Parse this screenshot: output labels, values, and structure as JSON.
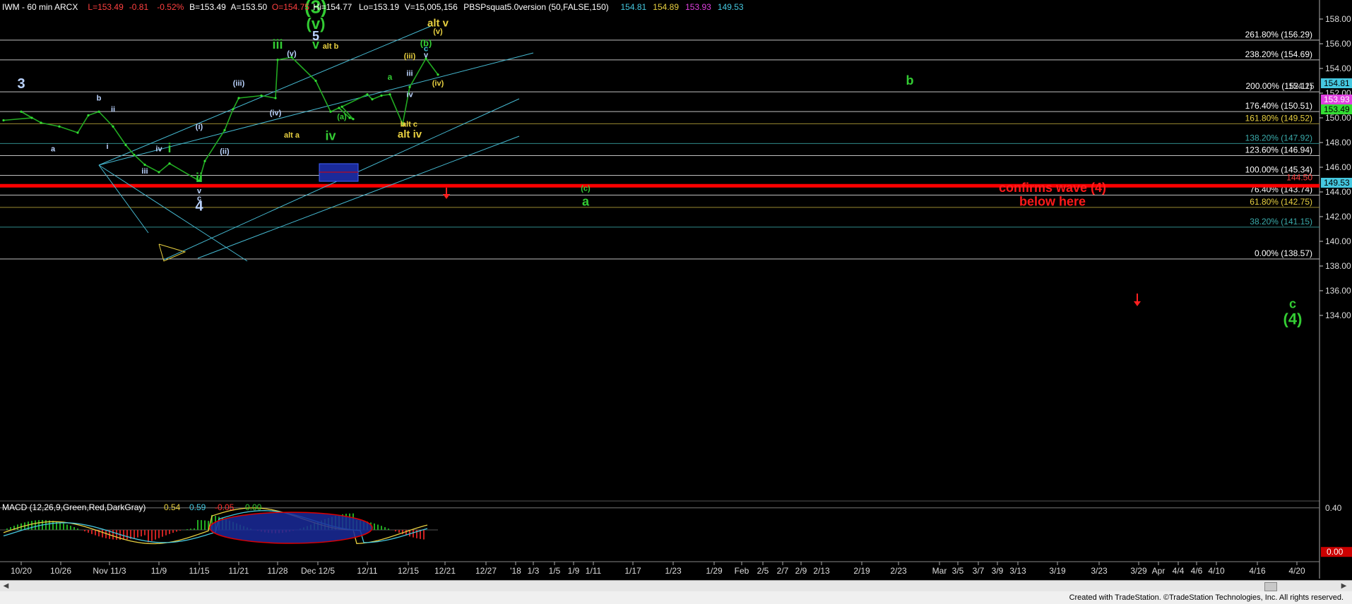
{
  "header": {
    "parts": [
      {
        "text": "IWM - 60 min  ARCX",
        "color": "#ffffff"
      },
      {
        "text": "L=153.49",
        "color": "#ff4040"
      },
      {
        "text": "-0.81",
        "color": "#ff4040"
      },
      {
        "text": "-0.52%",
        "color": "#ff4040"
      },
      {
        "text": "B=153.49",
        "color": "#ffffff"
      },
      {
        "text": "A=153.50",
        "color": "#ffffff"
      },
      {
        "text": "O=154.75",
        "color": "#ff4040"
      },
      {
        "text": "Hi=154.77",
        "color": "#ffffff"
      },
      {
        "text": "Lo=153.19",
        "color": "#ffffff"
      },
      {
        "text": "V=15,005,156",
        "color": "#ffffff"
      },
      {
        "text": "PBSPsquat5.0version (50,FALSE,150)",
        "color": "#ffffff"
      },
      {
        "text": "154.81",
        "color": "#45c8e0"
      },
      {
        "text": "154.89",
        "color": "#e8d040"
      },
      {
        "text": "153.93",
        "color": "#e040e0"
      },
      {
        "text": "149.53",
        "color": "#45c8e0"
      }
    ]
  },
  "macd": {
    "label": "MACD (12,26,9,Green,Red,DarkGray)",
    "values": [
      {
        "text": "0.54",
        "color": "#e8d040"
      },
      {
        "text": "0.59",
        "color": "#45c8e0"
      },
      {
        "text": "-0.05",
        "color": "#ff3030"
      },
      {
        "text": "0.00",
        "color": "#33cc33"
      }
    ],
    "axis_labels": [
      {
        "text": "0.40",
        "value": 0.4
      }
    ],
    "last_tag": {
      "text": "0.00",
      "value": -0.4
    }
  },
  "chart_data": {
    "type": "line",
    "title": "IWM - 60 min ARCX",
    "series": [
      {
        "name": "IWM",
        "x": [
          "10/16",
          "10/18",
          "10/20",
          "10/23",
          "10/26",
          "10/30",
          "11/1",
          "11/3",
          "11/6",
          "11/8",
          "11/9",
          "11/10",
          "11/13",
          "11/14",
          "11/15",
          "11/16",
          "11/17",
          "11/20",
          "11/21",
          "11/24",
          "11/27",
          "11/28",
          "11/29",
          "11/30",
          "12/1",
          "12/4",
          "12/5",
          "12/6",
          "12/7",
          "12/8",
          "12/11",
          "12/12",
          "12/13",
          "12/14",
          "12/15",
          "12/18",
          "12/19"
        ],
        "values": [
          149.8,
          150.0,
          150.5,
          149.6,
          149.3,
          148.8,
          150.2,
          150.5,
          149.3,
          147.8,
          147.0,
          146.2,
          145.6,
          146.3,
          144.9,
          146.5,
          149.0,
          150.7,
          151.6,
          151.8,
          151.6,
          154.7,
          154.9,
          153.0,
          150.5,
          150.8,
          150.0,
          149.9,
          150.9,
          151.9,
          151.5,
          151.8,
          151.9,
          149.5,
          152.5,
          154.8,
          153.5
        ]
      }
    ],
    "ylim": [
      132.0,
      159.0
    ],
    "y_ticks": [
      134,
      136,
      138,
      140,
      142,
      144,
      146,
      148,
      150,
      152,
      154,
      156,
      158
    ],
    "x_tick_labels": [
      "10/20",
      "10/26",
      "Nov 11/3",
      "11/9",
      "11/15",
      "11/21",
      "11/28",
      "Dec 12/5",
      "12/11",
      "12/15",
      "12/21",
      "12/27",
      "'18",
      "1/3",
      "1/5",
      "1/9",
      "1/11",
      "1/17",
      "1/23",
      "1/29",
      "Feb",
      "2/5",
      "2/7",
      "2/9",
      "2/13",
      "2/19",
      "2/23",
      "Mar",
      "3/5",
      "3/7",
      "3/9",
      "3/13",
      "3/19",
      "3/23",
      "3/29",
      "Apr",
      "4/4",
      "4/6",
      "4/10",
      "4/16",
      "4/20"
    ],
    "fib_levels": [
      {
        "label": "261.80% (156.29)",
        "value": 156.29,
        "color": "#ffffff"
      },
      {
        "label": "238.20% (154.69)",
        "value": 154.69,
        "color": "#ffffff"
      },
      {
        "label": "200.00% (152.11)",
        "value": 152.11,
        "color": "#ffffff"
      },
      {
        "label": "176.40% (150.51)",
        "value": 150.51,
        "color": "#ffffff"
      },
      {
        "label": "161.80% (149.52)",
        "value": 149.52,
        "color": "#e8d040"
      },
      {
        "label": "138.20% (147.92)",
        "value": 147.92,
        "color": "#3aaaaa"
      },
      {
        "label": "123.60% (146.94)",
        "value": 146.94,
        "color": "#ffffff"
      },
      {
        "label": "100.00% (145.34)",
        "value": 145.34,
        "color": "#ffffff"
      },
      {
        "label": "76.40% (143.74)",
        "value": 143.74,
        "color": "#ffffff"
      },
      {
        "label": "61.80% (142.75)",
        "value": 142.75,
        "color": "#e8d040"
      },
      {
        "label": "38.20% (141.15)",
        "value": 141.15,
        "color": "#3aaaaa"
      },
      {
        "label": "0.00% (138.57)",
        "value": 138.57,
        "color": "#ffffff"
      }
    ],
    "support_line": {
      "value": 144.5,
      "label": "144.50",
      "color": "#ff0000"
    },
    "price_tags": [
      {
        "text": "154.81",
        "value": 154.81,
        "bg": "#45c8e0",
        "fg": "#000000"
      },
      {
        "text": "154.25",
        "value": 154.25,
        "bg": "",
        "fg": "#cccccc"
      },
      {
        "text": "153.93",
        "value": 153.93,
        "bg": "#e040e0",
        "fg": "#ffffff"
      },
      {
        "text": "153.49",
        "value": 153.49,
        "bg": "#33dd33",
        "fg": "#000000"
      },
      {
        "text": "149.53",
        "value": 149.53,
        "bg": "#45c8e0",
        "fg": "#000000"
      }
    ],
    "annotations": [
      {
        "text": "(3)",
        "date": "11/30",
        "value": 158.5,
        "color": "#33cc33",
        "size": 26
      },
      {
        "text": "(v)",
        "date": "11/30",
        "value": 157.2,
        "color": "#33cc33",
        "size": 22
      },
      {
        "text": "5",
        "date": "11/30",
        "value": 156.3,
        "color": "#bbd4ff",
        "size": 18
      },
      {
        "text": "iii",
        "date": "11/28",
        "value": 155.6,
        "color": "#33cc33",
        "size": 18
      },
      {
        "text": "v",
        "date": "11/30",
        "value": 155.6,
        "color": "#33cc33",
        "size": 18
      },
      {
        "text": "alt b",
        "date": "12/1",
        "value": 155.6,
        "color": "#e8d040",
        "size": 11
      },
      {
        "text": "alt v",
        "date": "12/19",
        "value": 157.4,
        "color": "#e8d040",
        "size": 15
      },
      {
        "text": "(v)",
        "date": "12/19",
        "value": 156.8,
        "color": "#e8d040",
        "size": 11
      },
      {
        "text": "(b)",
        "date": "12/18",
        "value": 155.8,
        "color": "#33cc33",
        "size": 13
      },
      {
        "text": "c",
        "date": "12/18",
        "value": 155.4,
        "color": "#45c8e0",
        "size": 11
      },
      {
        "text": "v",
        "date": "12/18",
        "value": 154.9,
        "color": "#bbd4ff",
        "size": 11
      },
      {
        "text": "(iii)",
        "date": "12/15",
        "value": 154.8,
        "color": "#e8d040",
        "size": 11
      },
      {
        "text": "iii",
        "date": "12/15",
        "value": 153.4,
        "color": "#bbd4ff",
        "size": 11
      },
      {
        "text": "(iv)",
        "date": "12/19",
        "value": 152.6,
        "color": "#e8d040",
        "size": 11
      },
      {
        "text": "iv",
        "date": "12/15",
        "value": 151.7,
        "color": "#bbd4ff",
        "size": 11
      },
      {
        "text": "a",
        "date": "12/13",
        "value": 153.1,
        "color": "#33cc33",
        "size": 12
      },
      {
        "text": "b",
        "date": "12/14",
        "value": 149.3,
        "color": "#e8d040",
        "size": 11
      },
      {
        "text": "alt c",
        "date": "12/15",
        "value": 149.3,
        "color": "#e8d040",
        "size": 11
      },
      {
        "text": "alt iv",
        "date": "12/15",
        "value": 148.4,
        "color": "#e8d040",
        "size": 15
      },
      {
        "text": "(a)",
        "date": "12/7",
        "value": 149.9,
        "color": "#33cc33",
        "size": 11
      },
      {
        "text": "alt a",
        "date": "11/29",
        "value": 148.4,
        "color": "#e8d040",
        "size": 11
      },
      {
        "text": "iv",
        "date": "12/1",
        "value": 148.2,
        "color": "#33cc33",
        "size": 18
      },
      {
        "text": "(v)",
        "date": "11/29",
        "value": 155.0,
        "color": "#bbd4ff",
        "size": 11
      },
      {
        "text": "(iii)",
        "date": "11/21",
        "value": 152.6,
        "color": "#bbd4ff",
        "size": 11
      },
      {
        "text": "(iv)",
        "date": "11/27",
        "value": 150.2,
        "color": "#bbd4ff",
        "size": 11
      },
      {
        "text": "(ii)",
        "date": "11/17",
        "value": 147.1,
        "color": "#bbd4ff",
        "size": 11
      },
      {
        "text": "(i)",
        "date": "11/15",
        "value": 149.1,
        "color": "#bbd4ff",
        "size": 11
      },
      {
        "text": "i",
        "date": "11/14",
        "value": 147.2,
        "color": "#33cc33",
        "size": 18
      },
      {
        "text": "ii",
        "date": "11/15",
        "value": 144.8,
        "color": "#33cc33",
        "size": 18
      },
      {
        "text": "iv",
        "date": "11/13",
        "value": 147.3,
        "color": "#bbd4ff",
        "size": 11
      },
      {
        "text": "iii",
        "date": "11/10",
        "value": 145.5,
        "color": "#bbd4ff",
        "size": 11
      },
      {
        "text": "v",
        "date": "11/15",
        "value": 143.9,
        "color": "#bbd4ff",
        "size": 11
      },
      {
        "text": "c",
        "date": "11/15",
        "value": 143.3,
        "color": "#bbd4ff",
        "size": 11
      },
      {
        "text": "4",
        "date": "11/15",
        "value": 142.5,
        "color": "#bbd4ff",
        "size": 20
      },
      {
        "text": "3",
        "date": "10/17",
        "value": 152.4,
        "color": "#bbd4ff",
        "size": 20
      },
      {
        "text": "a",
        "date": "10/25",
        "value": 147.3,
        "color": "#bbd4ff",
        "size": 11
      },
      {
        "text": "b",
        "date": "11/3",
        "value": 151.4,
        "color": "#bbd4ff",
        "size": 11
      },
      {
        "text": "ii",
        "date": "11/6",
        "value": 150.5,
        "color": "#bbd4ff",
        "size": 11
      },
      {
        "text": "i",
        "date": "11/5",
        "value": 147.5,
        "color": "#bbd4ff",
        "size": 11
      },
      {
        "text": "(c)",
        "date": "1/5",
        "value": 144.1,
        "color": "#33cc33",
        "size": 11
      },
      {
        "text": "a",
        "date": "1/5",
        "value": 142.9,
        "color": "#33cc33",
        "size": 18
      },
      {
        "text": "b",
        "date": "2/23",
        "value": 152.7,
        "color": "#33cc33",
        "size": 18
      },
      {
        "text": "c",
        "date": "4/20",
        "value": 134.6,
        "color": "#33cc33",
        "size": 18
      },
      {
        "text": "(4)",
        "date": "4/20",
        "value": 133.3,
        "color": "#33cc33",
        "size": 22
      },
      {
        "text": "confirms wave (4)",
        "date": "3/9",
        "value": 144.0,
        "color": "#ff1a1a",
        "size": 18
      },
      {
        "text": "below here",
        "date": "3/9",
        "value": 142.9,
        "color": "#ff1a1a",
        "size": 18
      }
    ],
    "macd_ylim": [
      -0.5,
      0.5
    ],
    "footer": "Created with TradeStation. ©TradeStation Technologies, Inc. All rights reserved."
  }
}
